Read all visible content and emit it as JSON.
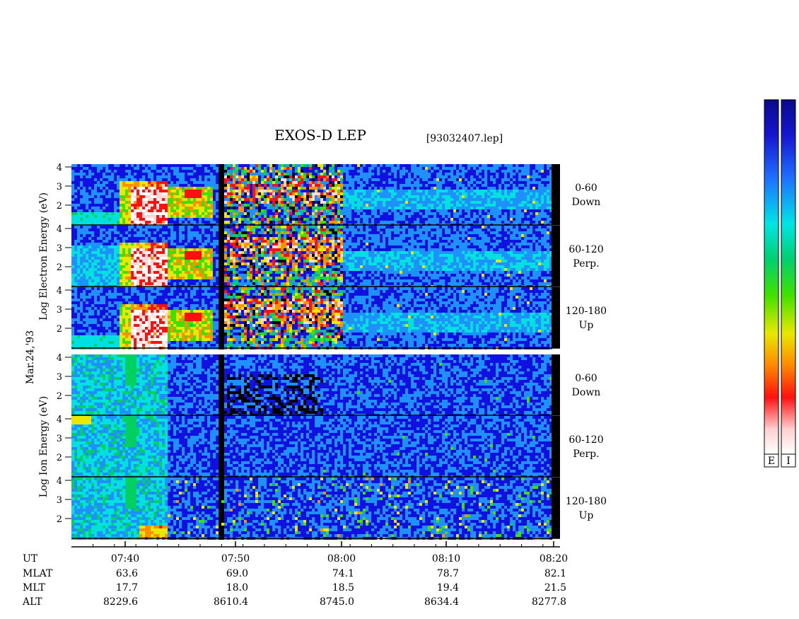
{
  "title": "EXOS-D LEP",
  "file_label": "[93032407.lep]",
  "date_label": "Mar.24,'93",
  "chart_data": {
    "type": "heatmap",
    "title": "EXOS-D LEP",
    "x": {
      "label": "UT",
      "ticks": [
        "07:40",
        "07:50",
        "08:00",
        "08:10",
        "08:20"
      ],
      "range": [
        "07:37",
        "08:20"
      ]
    },
    "groups": [
      {
        "ylabel_lines": [
          "Log",
          "Electron",
          "Energy",
          "(eV)"
        ],
        "panels": [
          {
            "angle": "0-60",
            "direction": "Down",
            "yticks": [
              "4",
              "3",
              "2"
            ],
            "ylim": [
              1,
              4
            ]
          },
          {
            "angle": "60-120",
            "direction": "Perp.",
            "yticks": [
              "4",
              "3",
              "2"
            ],
            "ylim": [
              1,
              4
            ]
          },
          {
            "angle": "120-180",
            "direction": "Up",
            "yticks": [
              "4",
              "3",
              "2"
            ],
            "ylim": [
              1,
              4
            ]
          }
        ]
      },
      {
        "ylabel_lines": [
          "Log",
          "Ion",
          "Energy",
          "(eV)"
        ],
        "panels": [
          {
            "angle": "0-60",
            "direction": "Down",
            "yticks": [
              "4",
              "3",
              "2"
            ],
            "ylim": [
              1,
              4
            ]
          },
          {
            "angle": "60-120",
            "direction": "Perp.",
            "yticks": [
              "4",
              "3",
              "2"
            ],
            "ylim": [
              1,
              4
            ]
          },
          {
            "angle": "120-180",
            "direction": "Up",
            "yticks": [
              "4",
              "3",
              "2"
            ],
            "ylim": [
              1,
              4
            ]
          }
        ]
      }
    ],
    "ephemeris": {
      "labels": [
        "UT",
        "MLAT",
        "MLT",
        "ALT"
      ],
      "MLAT": [
        "63.6",
        "69.0",
        "74.1",
        "78.7",
        "82.1"
      ],
      "MLT": [
        "17.7",
        "18.0",
        "18.5",
        "19.4",
        "21.5"
      ],
      "ALT": [
        "8229.6",
        "8610.4",
        "8745.0",
        "8634.4",
        "8277.8"
      ]
    },
    "colorbars": [
      {
        "label": "E"
      },
      {
        "label": "I"
      }
    ],
    "colormap": [
      "#0a0a8a",
      "#1010e0",
      "#1e90ff",
      "#00e0e0",
      "#00d060",
      "#40e000",
      "#e8e800",
      "#ff9000",
      "#ff1010",
      "#ffd8d8",
      "#ffffff"
    ]
  }
}
